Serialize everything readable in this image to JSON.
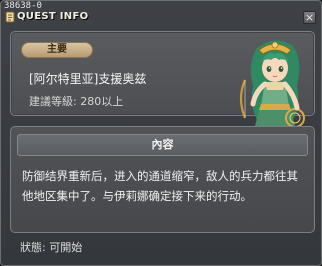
{
  "window": {
    "id_label": "38638-0",
    "title": "QUEST INFO",
    "close_label": "×"
  },
  "quest": {
    "badge": "主要",
    "name": "[阿尔特里亚]支援奥兹",
    "level_requirement": "建議等級: 280以上"
  },
  "content": {
    "header": "內容",
    "description": "防御结界重新后，进入的通道缩窄，敌人的兵力都往其他地区集中了。与伊莉娜确定接下来的行动。"
  },
  "status": {
    "label": "狀態: 可開始"
  },
  "colors": {
    "window_bg": "#3a3d41",
    "badge_bg": "#c9b08a",
    "npc_hair": "#3f9b72",
    "npc_gold": "#d9a84a"
  },
  "icons": {
    "title": "quest-scroll-icon",
    "close": "close-icon",
    "npc": "npc-portrait"
  }
}
